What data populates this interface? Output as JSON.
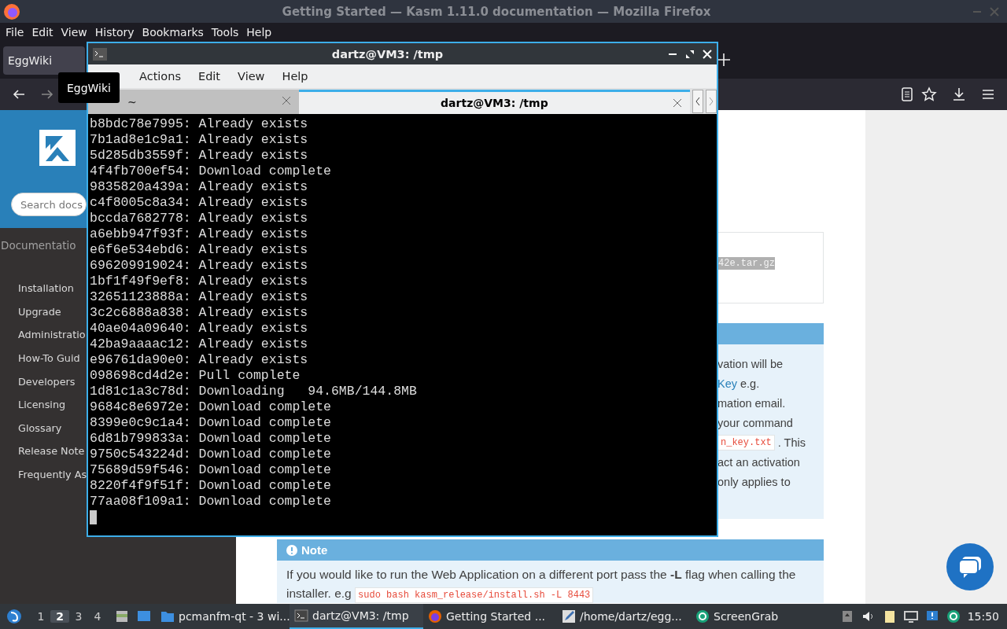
{
  "firefox": {
    "title": "Getting Started — Kasm 1.11.0 documentation — Mozilla Firefox",
    "menu": [
      "File",
      "Edit",
      "View",
      "History",
      "Bookmarks",
      "Tools",
      "Help"
    ],
    "tabs": [
      {
        "label": "EggWiki",
        "selected": true
      }
    ],
    "tooltip": "EggWiki"
  },
  "sidebar": {
    "search_placeholder": "Search docs",
    "caption": "Documentatio",
    "items": [
      "Installation",
      "Upgrade",
      "Administratio",
      "How-To Guid",
      "Developers",
      "Licensing",
      "Glossary",
      "Release Note",
      "Frequently As"
    ]
  },
  "page": {
    "code_fragment": "42e.tar.gz",
    "info_lines": [
      [
        {
          "kind": "text",
          "text": "vation will be"
        }
      ],
      [
        {
          "kind": "link",
          "text": "Key"
        },
        {
          "kind": "text",
          "text": "e.g."
        }
      ],
      [
        {
          "kind": "text",
          "text": "mation email."
        }
      ],
      [
        {
          "kind": "text",
          "text": "your command"
        }
      ],
      [
        {
          "kind": "code",
          "text": "n_key.txt"
        },
        {
          "kind": "text",
          "text": ". This"
        }
      ],
      [
        {
          "kind": "text",
          "text": "act an activation"
        }
      ],
      [
        {
          "kind": "text",
          "text": "only applies to"
        }
      ]
    ],
    "note": {
      "title": "Note",
      "text": "If you would like to run the Web Application on a different port pass the **-L** flag when calling the installer. e.g",
      "code": "sudo bash kasm_release/install.sh -L 8443"
    }
  },
  "terminal": {
    "title": "dartz@VM3: /tmp",
    "menu": [
      "Actions",
      "Edit",
      "View",
      "Help"
    ],
    "tabs": [
      {
        "label": "~",
        "selected": false
      },
      {
        "label": "dartz@VM3: /tmp",
        "selected": true
      }
    ],
    "lines": [
      "b8bdc78e7995: Already exists",
      "7b1ad8e1c9a1: Already exists",
      "5d285db3559f: Already exists",
      "4f4fb700ef54: Download complete",
      "9835820a439a: Already exists",
      "c4f8005c8a34: Already exists",
      "bccda7682778: Already exists",
      "a6ebb947f93f: Already exists",
      "e6f6e534ebd6: Already exists",
      "696209919024: Already exists",
      "1bf1f49f9ef8: Already exists",
      "32651123888a: Already exists",
      "3c2c6888a838: Already exists",
      "40ae04a09640: Already exists",
      "42ba9aaaac12: Already exists",
      "e96761da90e0: Already exists",
      "098698cd4d2e: Pull complete",
      "1d81c1a3c78d: Downloading   94.6MB/144.8MB",
      "9684c8e6972e: Download complete",
      "8399e0c9c1a4: Download complete",
      "6d81b799833a: Download complete",
      "9750c543224d: Download complete",
      "75689d59f546: Download complete",
      "8220f4f9f51f: Download complete",
      "77aa08f109a1: Download complete"
    ]
  },
  "taskbar": {
    "workspaces": [
      {
        "label": "1",
        "selected": false
      },
      {
        "label": "2",
        "selected": true
      },
      {
        "label": "3",
        "selected": false
      },
      {
        "label": "4",
        "selected": false
      }
    ],
    "tasks": [
      {
        "kind": "folder",
        "label": "pcmanfm-qt - 3 wi...",
        "selected": false
      },
      {
        "kind": "terminal",
        "label": "dartz@VM3: /tmp",
        "selected": true
      },
      {
        "kind": "browser",
        "label": "Getting Started ...",
        "selected": false
      },
      {
        "kind": "editor",
        "label": "/home/dartz/egg...",
        "selected": false
      },
      {
        "kind": "grab",
        "label": "ScreenGrab",
        "selected": false
      }
    ],
    "clock": "15:50"
  }
}
